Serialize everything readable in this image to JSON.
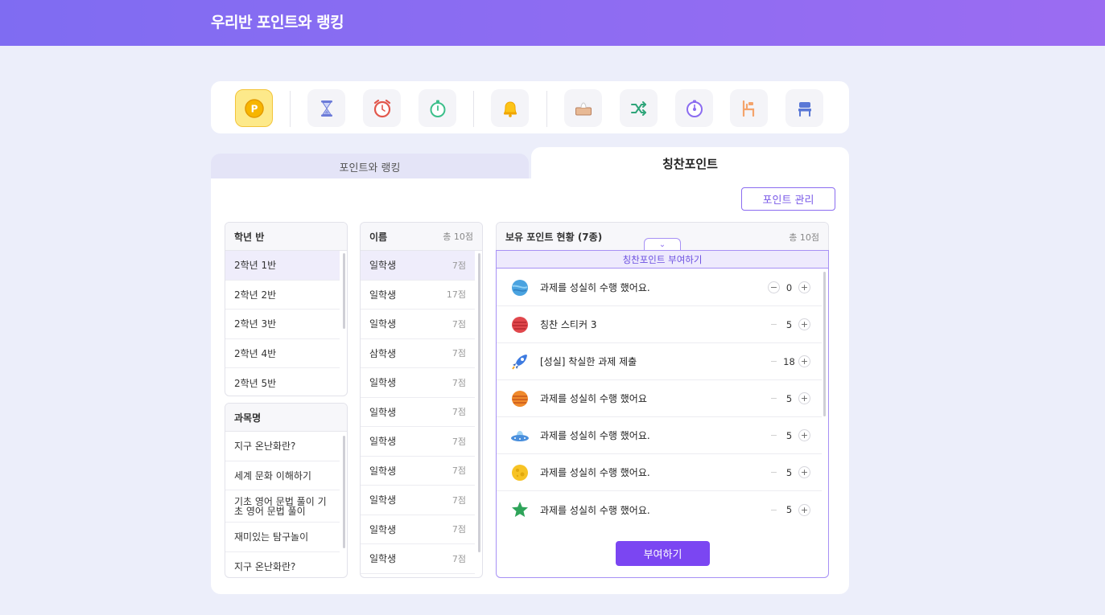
{
  "header": {
    "title": "우리반 포인트와 랭킹"
  },
  "toolbar": {
    "tools": [
      {
        "icon": "point-coin-icon"
      },
      {
        "icon": "hourglass-icon"
      },
      {
        "icon": "alarm-clock-icon"
      },
      {
        "icon": "stopwatch-icon"
      },
      {
        "icon": "bell-icon"
      },
      {
        "icon": "tissue-box-icon"
      },
      {
        "icon": "shuffle-icon"
      },
      {
        "icon": "timer-dial-icon"
      },
      {
        "icon": "seat-chart-icon"
      },
      {
        "icon": "chair-icon"
      }
    ]
  },
  "tabs": {
    "left": "포인트와 랭킹",
    "right": "칭찬포인트"
  },
  "manage_button": "포인트 관리",
  "grade_panel": {
    "title": "학년 반",
    "items": [
      "2학년 1반",
      "2학년 2반",
      "2학년 3반",
      "2학년 4반",
      "2학년 5반"
    ]
  },
  "subject_panel": {
    "title": "과목명",
    "items": [
      "지구 온난화란?",
      "세계 문화 이해하기",
      "기초 영어 문법 풀이 기초 영어 문법 풀이",
      "재미있는 탐구놀이",
      "지구 온난화란?"
    ]
  },
  "name_panel": {
    "title": "이름",
    "total": "총 10점",
    "rows": [
      {
        "name": "일학생",
        "pts": "7점"
      },
      {
        "name": "일학생",
        "pts": "17점"
      },
      {
        "name": "일학생",
        "pts": "7점"
      },
      {
        "name": "삼학생",
        "pts": "7점"
      },
      {
        "name": "일학생",
        "pts": "7점"
      },
      {
        "name": "일학생",
        "pts": "7점"
      },
      {
        "name": "일학생",
        "pts": "7점"
      },
      {
        "name": "일학생",
        "pts": "7점"
      },
      {
        "name": "일학생",
        "pts": "7점"
      },
      {
        "name": "일학생",
        "pts": "7점"
      },
      {
        "name": "일학생",
        "pts": "7점"
      }
    ]
  },
  "points_panel": {
    "title": "보유 포인트 현황 (7종)",
    "total": "총 10점",
    "award_title": "칭찬포인트 부여하기",
    "rows": [
      {
        "icon": "blue-planet-icon",
        "label": "과제를 성실히 수행 했어요.",
        "value": "0"
      },
      {
        "icon": "red-planet-icon",
        "label": "칭찬 스티커 3",
        "value": "5"
      },
      {
        "icon": "rocket-icon",
        "label": "[성실] 착실한 과제 제출",
        "value": "18"
      },
      {
        "icon": "orange-planet-icon",
        "label": "과제를 성실히 수행 했어요",
        "value": "5"
      },
      {
        "icon": "ufo-icon",
        "label": "과제를 성실히 수행 했어요.",
        "value": "5"
      },
      {
        "icon": "moon-icon",
        "label": "과제를 성실히 수행 했어요.",
        "value": "5"
      },
      {
        "icon": "star-icon",
        "label": "과제를 성실히 수행 했어요.",
        "value": "5"
      }
    ],
    "give_button": "부여하기"
  }
}
